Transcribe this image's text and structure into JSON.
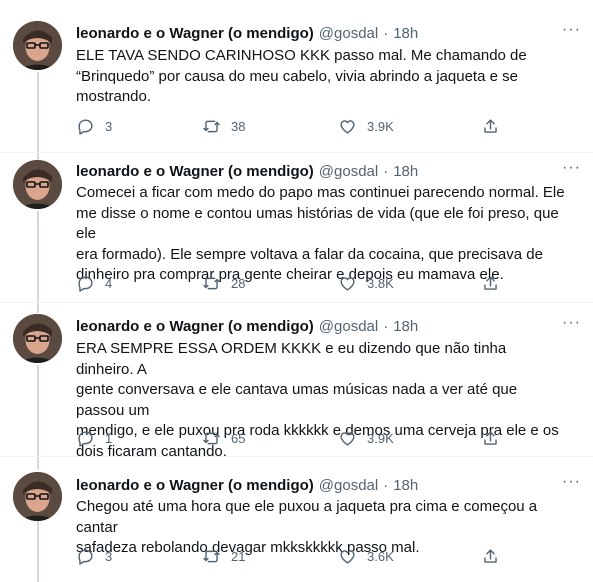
{
  "tweets": [
    {
      "name": "leonardo e o Wagner (o mendigo)",
      "handle": "@gosdal",
      "sep": "·",
      "time": "18h",
      "lines": [
        "ELE TAVA SENDO CARINHOSO KKK passo mal. Me chamando de",
        "“Brinquedo” por causa do meu cabelo, vivia abrindo a jaqueta e se",
        "mostrando."
      ],
      "replies": "3",
      "retweets": "38",
      "likes": "3.9K"
    },
    {
      "name": "leonardo e o Wagner (o mendigo)",
      "handle": "@gosdal",
      "sep": "·",
      "time": "18h",
      "lines": [
        "Comecei a ficar com medo do papo mas continuei parecendo normal. Ele",
        "me disse o nome e contou umas histórias de vida (que ele foi preso, que ele",
        "era formado). Ele sempre voltava a falar da cocaina, que precisava de",
        "dinheiro pra comprar pra gente cheirar e depois eu mamava ele."
      ],
      "replies": "4",
      "retweets": "28",
      "likes": "3.8K"
    },
    {
      "name": "leonardo e o Wagner (o mendigo)",
      "handle": "@gosdal",
      "sep": "·",
      "time": "18h",
      "lines": [
        "ERA SEMPRE ESSA ORDEM KKKK e eu dizendo que não tinha dinheiro. A",
        "gente conversava e ele cantava umas músicas nada a ver até que passou um",
        "mendigo, e ele puxou pra roda kkkkkk e demos uma cerveja pra ele e os",
        "dois ficaram cantando."
      ],
      "replies": "1",
      "retweets": "65",
      "likes": "3.9K"
    },
    {
      "name": "leonardo e o Wagner (o mendigo)",
      "handle": "@gosdal",
      "sep": "·",
      "time": "18h",
      "lines": [
        "Chegou até uma hora que ele puxou a jaqueta pra cima e começou a cantar",
        "safadeza rebolando devagar mkkskkkkk passo mal."
      ],
      "replies": "3",
      "retweets": "21",
      "likes": "3.6K"
    }
  ],
  "icons": {
    "more": "more-options-icon",
    "reply": "reply-icon",
    "retweet": "retweet-icon",
    "like": "like-icon",
    "share": "share-icon"
  },
  "colors": {
    "text": "#0f1419",
    "secondary": "#536471",
    "thread_line": "#cfd9de",
    "divider": "#eff3f4"
  }
}
